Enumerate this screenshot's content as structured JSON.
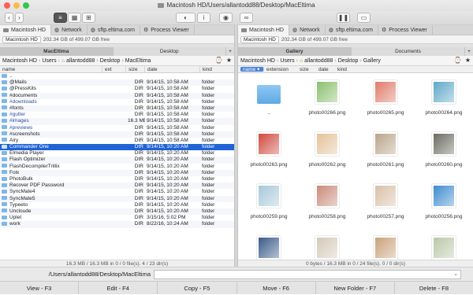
{
  "window": {
    "title": "Macintosh HD/Users/allantodd88/Desktop/MacEltima"
  },
  "colors": {
    "selection": "#1f63d4",
    "folder": "#7fb7e6",
    "tag_blue": "#2c4f9e"
  },
  "left_tabs": [
    {
      "label": "Macintosh HD",
      "icon": "hard-drive-icon",
      "active": true
    },
    {
      "label": "Network",
      "icon": "network-icon"
    },
    {
      "label": "sftp.eltima.com",
      "icon": "globe-icon"
    },
    {
      "label": "Process Viewer",
      "icon": "process-icon"
    }
  ],
  "right_tabs": [
    {
      "label": "Macintosh HD",
      "icon": "hard-drive-icon",
      "active": true
    },
    {
      "label": "Network",
      "icon": "network-icon"
    },
    {
      "label": "sftp.eltima.com",
      "icon": "globe-icon"
    },
    {
      "label": "Process Viewer",
      "icon": "process-icon"
    }
  ],
  "drive": {
    "name": "Macintosh HD",
    "free": "202.34 GB of 499.07 GB free"
  },
  "left_panel": {
    "tabs": [
      "MacEltima",
      "Desktop"
    ],
    "breadcrumb": [
      "Macintosh HD",
      "Users",
      "allantodd88",
      "Desktop",
      "MacEltima"
    ],
    "columns": [
      "name",
      "ext",
      "size",
      "date",
      "kind"
    ],
    "rows": [
      {
        "name": "..",
        "ext": "",
        "size": "",
        "date": "",
        "kind": ""
      },
      {
        "name": "@Mails",
        "ext": "",
        "size": "DIR",
        "date": "9/14/15, 10:58 AM",
        "kind": "folder"
      },
      {
        "name": "@PressKits",
        "ext": "",
        "size": "DIR",
        "date": "9/14/15, 10:58 AM",
        "kind": "folder"
      },
      {
        "name": "#documents",
        "ext": "",
        "size": "DIR",
        "date": "9/14/15, 10:58 AM",
        "kind": "folder"
      },
      {
        "name": "#downloads",
        "ext": "",
        "size": "DIR",
        "date": "9/14/15, 10:58 AM",
        "kind": "folder",
        "tagged": true
      },
      {
        "name": "#fonts",
        "ext": "",
        "size": "DIR",
        "date": "9/14/15, 10:58 AM",
        "kind": "folder"
      },
      {
        "name": "#gutter",
        "ext": "",
        "size": "DIR",
        "date": "9/14/15, 10:58 AM",
        "kind": "folder",
        "tagged": true
      },
      {
        "name": "#images",
        "ext": "",
        "size": "16.3 MB",
        "date": "9/14/15, 10:58 AM",
        "kind": "folder",
        "tagged": true
      },
      {
        "name": "#previews",
        "ext": "",
        "size": "DIR",
        "date": "9/14/15, 10:58 AM",
        "kind": "folder",
        "tagged": true
      },
      {
        "name": "#screenshots",
        "ext": "",
        "size": "DIR",
        "date": "9/14/15, 10:58 AM",
        "kind": "folder"
      },
      {
        "name": "Airy",
        "ext": "",
        "size": "DIR",
        "date": "9/14/15, 10:58 AM",
        "kind": "folder"
      },
      {
        "name": "Commander One",
        "ext": "",
        "size": "DIR",
        "date": "9/14/15, 10:20 AM",
        "kind": "folder",
        "selected": true
      },
      {
        "name": "Elmedia Player",
        "ext": "",
        "size": "DIR",
        "date": "9/14/15, 10:20 AM",
        "kind": "folder"
      },
      {
        "name": "Flash Optimizer",
        "ext": "",
        "size": "DIR",
        "date": "9/14/15, 10:20 AM",
        "kind": "folder"
      },
      {
        "name": "FlashDecompilerTrillix",
        "ext": "",
        "size": "DIR",
        "date": "9/14/15, 10:20 AM",
        "kind": "folder"
      },
      {
        "name": "Folx",
        "ext": "",
        "size": "DIR",
        "date": "9/14/15, 10:20 AM",
        "kind": "folder"
      },
      {
        "name": "PhotoBulk",
        "ext": "",
        "size": "DIR",
        "date": "9/14/15, 10:20 AM",
        "kind": "folder"
      },
      {
        "name": "Recover PDF Password",
        "ext": "",
        "size": "DIR",
        "date": "9/14/15, 10:20 AM",
        "kind": "folder"
      },
      {
        "name": "SyncMate4",
        "ext": "",
        "size": "DIR",
        "date": "9/14/15, 10:20 AM",
        "kind": "folder"
      },
      {
        "name": "SyncMate5",
        "ext": "",
        "size": "DIR",
        "date": "9/14/15, 10:20 AM",
        "kind": "folder"
      },
      {
        "name": "Typeeto",
        "ext": "",
        "size": "DIR",
        "date": "9/14/15, 10:20 AM",
        "kind": "folder"
      },
      {
        "name": "Uncloude",
        "ext": "",
        "size": "DIR",
        "date": "9/14/15, 10:20 AM",
        "kind": "folder"
      },
      {
        "name": "Uplet",
        "ext": "",
        "size": "DIR",
        "date": "3/15/16, 5:02 PM",
        "kind": "folder"
      },
      {
        "name": "work",
        "ext": "",
        "size": "DIR",
        "date": "8/22/16, 10:24 AM",
        "kind": "folder"
      }
    ],
    "status": "16.3 MB / 16.3 MB in 0 / 0 file(s). 4 / 23 dir(s)"
  },
  "right_panel": {
    "tabs": [
      "Gallery",
      "Documents"
    ],
    "breadcrumb": [
      "Macintosh HD",
      "Users",
      "allantodd88",
      "Desktop",
      "Gallery"
    ],
    "columns": [
      "name",
      "extension",
      "size",
      "date",
      "kind"
    ],
    "sort_indicator": "▾",
    "items": [
      {
        "label": "..",
        "type": "folder"
      },
      {
        "label": "photo00266.png",
        "color": "#8bbf6e"
      },
      {
        "label": "photo00265.png",
        "color": "#e07b6a"
      },
      {
        "label": "photo00264.png",
        "color": "#5fa8c8"
      },
      {
        "label": "photo00263.png",
        "color": "#d04a3e"
      },
      {
        "label": "photo00262.png",
        "color": "#e4c39a"
      },
      {
        "label": "photo00261.png",
        "color": "#b8a58a"
      },
      {
        "label": "photo00260.png",
        "color": "#6c6c62"
      },
      {
        "label": "photo00259.png",
        "color": "#a6c8d8"
      },
      {
        "label": "photo00258.png",
        "color": "#c98a7a"
      },
      {
        "label": "photo00257.png",
        "color": "#d8c0a8"
      },
      {
        "label": "photo00256.png",
        "color": "#3f8bd0"
      },
      {
        "label": "",
        "color": "#3a5a8a"
      },
      {
        "label": "",
        "color": "#d4c9b8"
      },
      {
        "label": "",
        "color": "#c9a27a"
      },
      {
        "label": "",
        "color": "#b9c8a8"
      }
    ],
    "status": "0 bytes / 16.3 MB in 0 / 24 file(s). 0 / 0 dir(s)"
  },
  "command_line": {
    "path": "/Users/allantodd88/Desktop/MacEltima",
    "value": ""
  },
  "fkeys": [
    "View - F3",
    "Edit - F4",
    "Copy - F5",
    "Move - F6",
    "New Folder - F7",
    "Delete - F8"
  ]
}
